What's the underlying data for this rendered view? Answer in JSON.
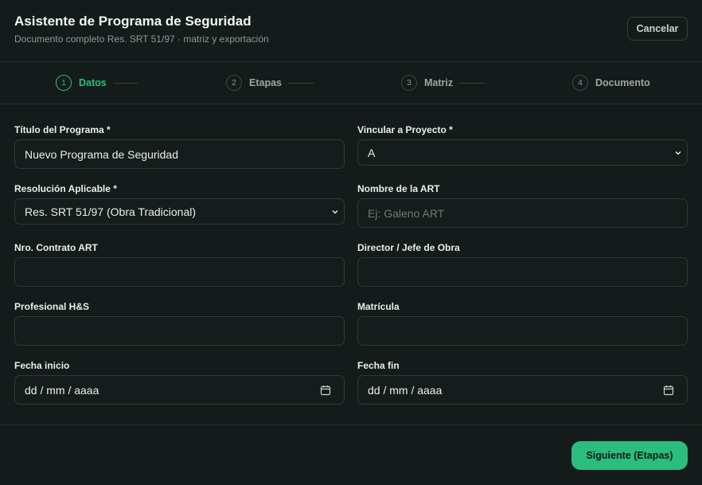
{
  "header": {
    "title": "Asistente de Programa de Seguridad",
    "subtitle": "Documento completo Res. SRT 51/97 · matriz y exportación",
    "cancel_label": "Cancelar"
  },
  "steps": [
    {
      "num": "1",
      "label": "Datos",
      "active": true
    },
    {
      "num": "2",
      "label": "Etapas",
      "active": false
    },
    {
      "num": "3",
      "label": "Matriz",
      "active": false
    },
    {
      "num": "4",
      "label": "Documento",
      "active": false
    }
  ],
  "form": {
    "titulo": {
      "label": "Título del Programa *",
      "value": "Nuevo Programa de Seguridad"
    },
    "proyecto": {
      "label": "Vincular a Proyecto *",
      "value": "A"
    },
    "resolucion": {
      "label": "Resolución Aplicable *",
      "value": "Res. SRT 51/97 (Obra Tradicional)"
    },
    "art": {
      "label": "Nombre de la ART",
      "placeholder": "Ej: Galeno ART"
    },
    "contrato": {
      "label": "Nro. Contrato ART",
      "value": ""
    },
    "director": {
      "label": "Director / Jefe de Obra",
      "value": ""
    },
    "profesional": {
      "label": "Profesional H&S",
      "value": ""
    },
    "matricula": {
      "label": "Matrícula",
      "value": ""
    },
    "fecha_inicio": {
      "label": "Fecha inicio",
      "placeholder": "dd / mm / aaaa"
    },
    "fecha_fin": {
      "label": "Fecha fin",
      "placeholder": "dd / mm / aaaa"
    }
  },
  "footer": {
    "next_label": "Siguiente (Etapas)"
  },
  "colors": {
    "accent": "#2bbd7e",
    "background": "#131c1a"
  }
}
